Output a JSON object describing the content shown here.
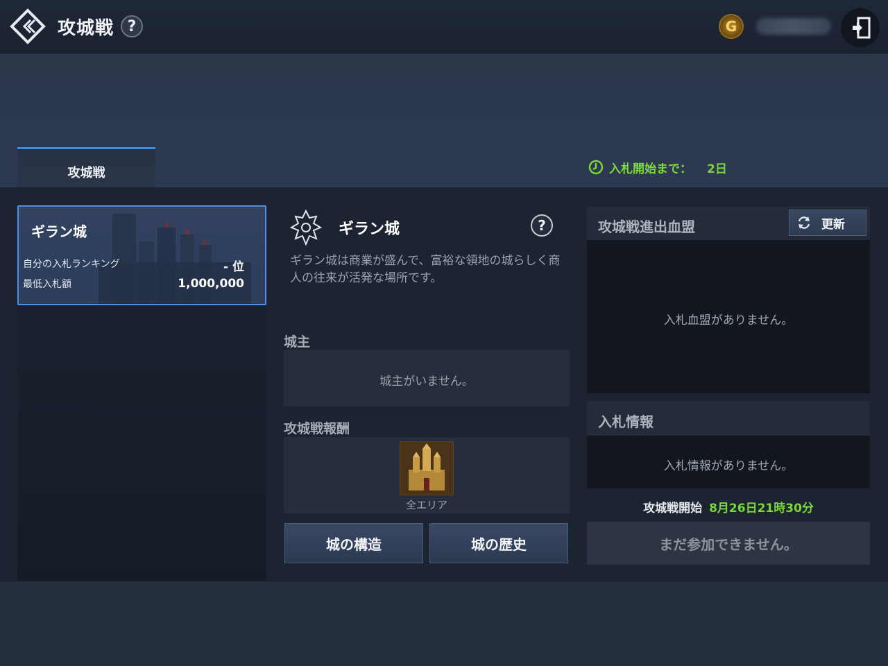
{
  "header": {
    "title": "攻城戦",
    "help_glyph": "?",
    "currency_icon_letter": "G",
    "currency_value_hidden": true
  },
  "tabs": [
    {
      "label": "攻城戦",
      "active": true
    }
  ],
  "bidding_timer": {
    "label": "入札開始まで：",
    "value": "2日"
  },
  "castle_list": [
    {
      "name": "ギラン城",
      "my_rank_label": "自分の入札ランキング",
      "my_rank_value": "- 位",
      "min_bid_label": "最低入札額",
      "min_bid_value": "1,000,000",
      "selected": true
    }
  ],
  "detail": {
    "name": "ギラン城",
    "help_glyph": "?",
    "description": "ギラン城は商業が盛んで、富裕な領地の城らしく商人の往来が活発な場所です。",
    "lord_label": "城主",
    "lord_empty": "城主がいません。",
    "reward_label": "攻城戦報酬",
    "reward_item_label": "全エリア",
    "structure_button": "城の構造",
    "history_button": "城の歴史"
  },
  "clans": {
    "title": "攻城戦進出血盟",
    "refresh_label": "更新",
    "empty": "入札血盟がありません。"
  },
  "bid_info": {
    "title": "入札情報",
    "empty": "入札情報がありません。"
  },
  "siege_start": {
    "label": "攻城戦開始",
    "date": "8月26日21時30分"
  },
  "join_button": "まだ参加できません。",
  "colors": {
    "accent_blue": "#4f8fe6",
    "accent_green": "#7bd83a",
    "panel_dark": "#11161f"
  }
}
